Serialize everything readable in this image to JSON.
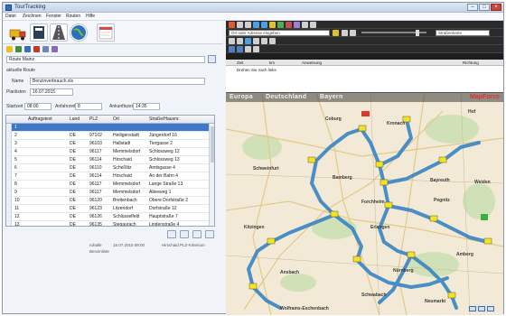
{
  "window": {
    "title": "TourTracking"
  },
  "menu": [
    "Datei",
    "Zeichnen",
    "Fenster",
    "Routen",
    "Hilfe"
  ],
  "colors": {
    "route": "#2f7fc4",
    "accent": "#3d78c9",
    "map_bg": "#f2ead6",
    "stop_marker": "#f2e230"
  },
  "form": {
    "name_value": "Route Mainz",
    "subtitle": "aktuelle Route",
    "name_label": "Name",
    "name_field": "Benzinverbrauch.xls",
    "date_label": "Planlisten",
    "date_value": "16.07.2015",
    "start_label": "Startzeit",
    "start_value": "08:00",
    "stops_label": "Anfahrzeit",
    "stops_value": "8",
    "end_label": "Ankunftszeit",
    "end_value": "14:35"
  },
  "table": {
    "headers": [
      "",
      "Auftragstext",
      "Land",
      "PLZ",
      "Ort",
      "Straße/Hausnr."
    ],
    "rows": [
      {
        "nr": "1",
        "land": "",
        "plz": "",
        "ort": "",
        "strasse": "",
        "selected": true
      },
      {
        "nr": "2",
        "land": "DE",
        "plz": "97102",
        "ort": "Heiligenstadt",
        "strasse": "Jüngerdorf 16"
      },
      {
        "nr": "3",
        "land": "DE",
        "plz": "96103",
        "ort": "Hallstadt",
        "strasse": "Tiergasse 2"
      },
      {
        "nr": "4",
        "land": "DE",
        "plz": "96117",
        "ort": "Memmelsdorf",
        "strasse": "Schlossweg 12"
      },
      {
        "nr": "5",
        "land": "DE",
        "plz": "96114",
        "ort": "Hirschaid",
        "strasse": "Schlossweg 13"
      },
      {
        "nr": "6",
        "land": "DE",
        "plz": "96110",
        "ort": "Scheßlitz",
        "strasse": "Amtsgasse 4"
      },
      {
        "nr": "7",
        "land": "DE",
        "plz": "96114",
        "ort": "Hirschaid",
        "strasse": "An der Bahn 4"
      },
      {
        "nr": "8",
        "land": "DE",
        "plz": "96117",
        "ort": "Memmelsdorf",
        "strasse": "Lange Straße 13"
      },
      {
        "nr": "9",
        "land": "DE",
        "plz": "96117",
        "ort": "Memmelsdorf",
        "strasse": "Alleeweg 1"
      },
      {
        "nr": "10",
        "land": "DE",
        "plz": "96120",
        "ort": "Breitenbach",
        "strasse": "Obere Dorfstraße 2"
      },
      {
        "nr": "11",
        "land": "DE",
        "plz": "96123",
        "ort": "Litzendorf",
        "strasse": "Dorfstraße 12"
      },
      {
        "nr": "12",
        "land": "DE",
        "plz": "96126",
        "ort": "Schlüsselfeld",
        "strasse": "Hauptstraße 7"
      },
      {
        "nr": "13",
        "land": "DE",
        "plz": "96135",
        "ort": "Stegaurach",
        "strasse": "Lindenstraße 4"
      }
    ]
  },
  "status": {
    "line1_left": "ruhalle",
    "line1_mid": "16.07.2015 08:00",
    "line1_right": "Hirschaid PLZ-Kriterium",
    "line2": "Benzinliste"
  },
  "map": {
    "search_placeholder": "Ort oder Adresse eingeben",
    "layer_select": "Straßenkarte",
    "list_headers": [
      "",
      "Zeit",
      "km",
      "Anweisung",
      "",
      "Richtung"
    ],
    "list_rows": [
      {
        "text": "Drehen Sie nach links"
      }
    ],
    "breadcrumb": [
      "Europa",
      "Deutschland",
      "Bayern"
    ],
    "logo": "MapForce",
    "places": [
      "Coburg",
      "Kronach",
      "Hof",
      "Bamberg",
      "Erlangen",
      "Nürnberg",
      "Bayreuth",
      "Forchheim",
      "Schweinfurt",
      "Kitzingen",
      "Pegnitz",
      "Weiden",
      "Amberg",
      "Neumarkt",
      "Schwabach",
      "Ansbach",
      "Wolframs-Eschenbach"
    ]
  }
}
